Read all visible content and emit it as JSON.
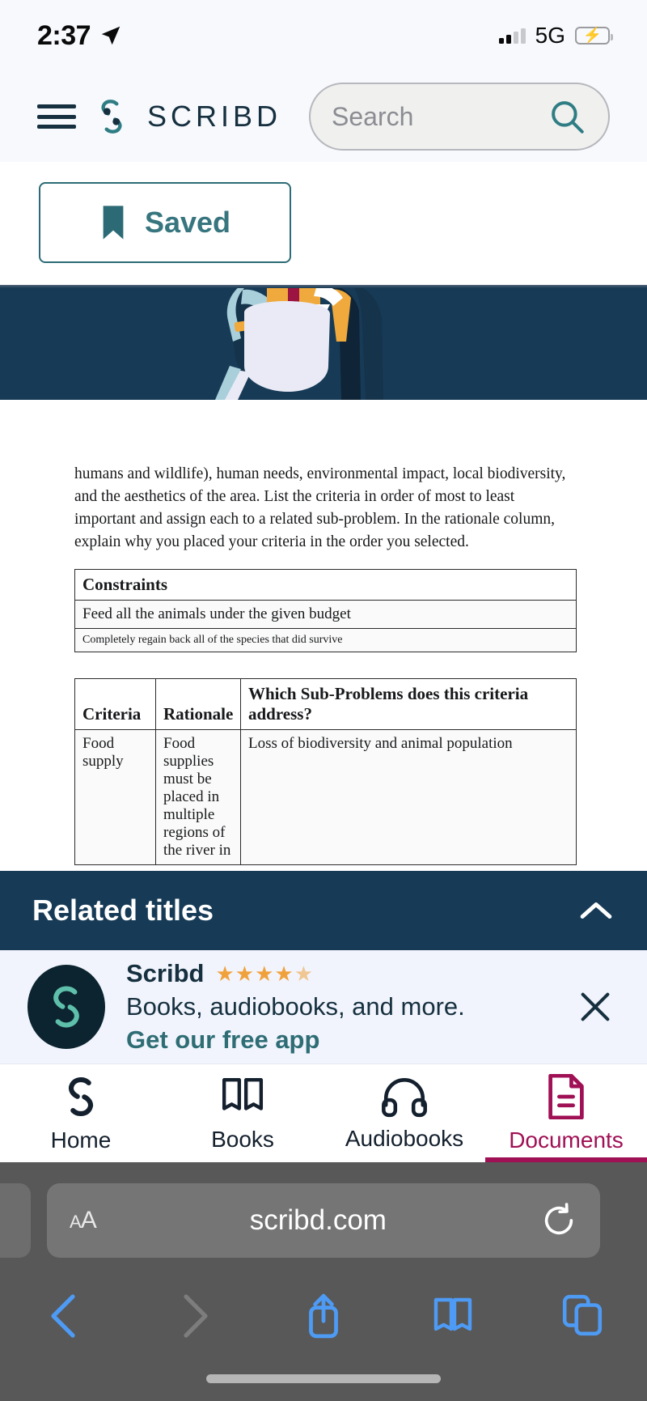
{
  "status_bar": {
    "time": "2:37",
    "location_icon": "location-arrow-icon",
    "signal_icon": "cellular-bars-icon",
    "network": "5G",
    "battery_icon": "battery-charging-icon"
  },
  "header": {
    "menu_icon": "hamburger-menu-icon",
    "logo_icon": "scribd-logo-icon",
    "wordmark": "SCRIBD",
    "search": {
      "placeholder": "Search",
      "icon": "search-icon"
    }
  },
  "toolbar": {
    "saved_label": "Saved",
    "saved_icon": "bookmark-filled-icon"
  },
  "hero": {
    "background_color": "#173b57",
    "illustration": "people-holding-book-illustration"
  },
  "document": {
    "paragraph": "humans and wildlife), human needs, environmental impact, local biodiversity, and the aesthetics of the area. List the criteria in order of most to least important and assign each to a related sub-problem. In the rationale column, explain why you placed your criteria in the order you selected.",
    "constraints_table": {
      "header": "Constraints",
      "rows": [
        "Feed all the animals under the given budget",
        "Completely regain back all of the species that did survive"
      ]
    },
    "criteria_table": {
      "headers": [
        "Criteria",
        "Rationale",
        "Which Sub-Problems does this criteria address?"
      ],
      "rows": [
        {
          "criteria": "Food supply",
          "rationale": "Food supplies must be placed in multiple regions of the river in",
          "subproblems": "Loss of biodiversity and animal population"
        }
      ]
    }
  },
  "related_titles": {
    "label": "Related titles",
    "collapse_icon": "chevron-up-icon"
  },
  "app_promo": {
    "name": "Scribd",
    "rating_stars": "★★★★",
    "rating_half": "★",
    "subtitle": "Books, audiobooks, and more.",
    "cta": "Get our free app",
    "close_icon": "close-x-icon",
    "avatar_icon": "scribd-logo-icon",
    "star_color": "#f0a13c"
  },
  "tab_bar": {
    "items": [
      {
        "label": "Home",
        "icon": "scribd-logo-icon",
        "active": false
      },
      {
        "label": "Books",
        "icon": "open-book-icon",
        "active": false
      },
      {
        "label": "Audiobooks",
        "icon": "headphones-icon",
        "active": false
      },
      {
        "label": "Documents",
        "icon": "document-icon",
        "active": true
      }
    ],
    "active_color": "#a01055"
  },
  "browser": {
    "text_size_label": "AA",
    "url": "scribd.com",
    "reload_icon": "reload-icon",
    "back_icon": "chevron-left-icon",
    "forward_icon": "chevron-right-icon",
    "share_icon": "share-icon",
    "bookmarks_icon": "book-icon",
    "tabs_icon": "tabs-icon"
  }
}
